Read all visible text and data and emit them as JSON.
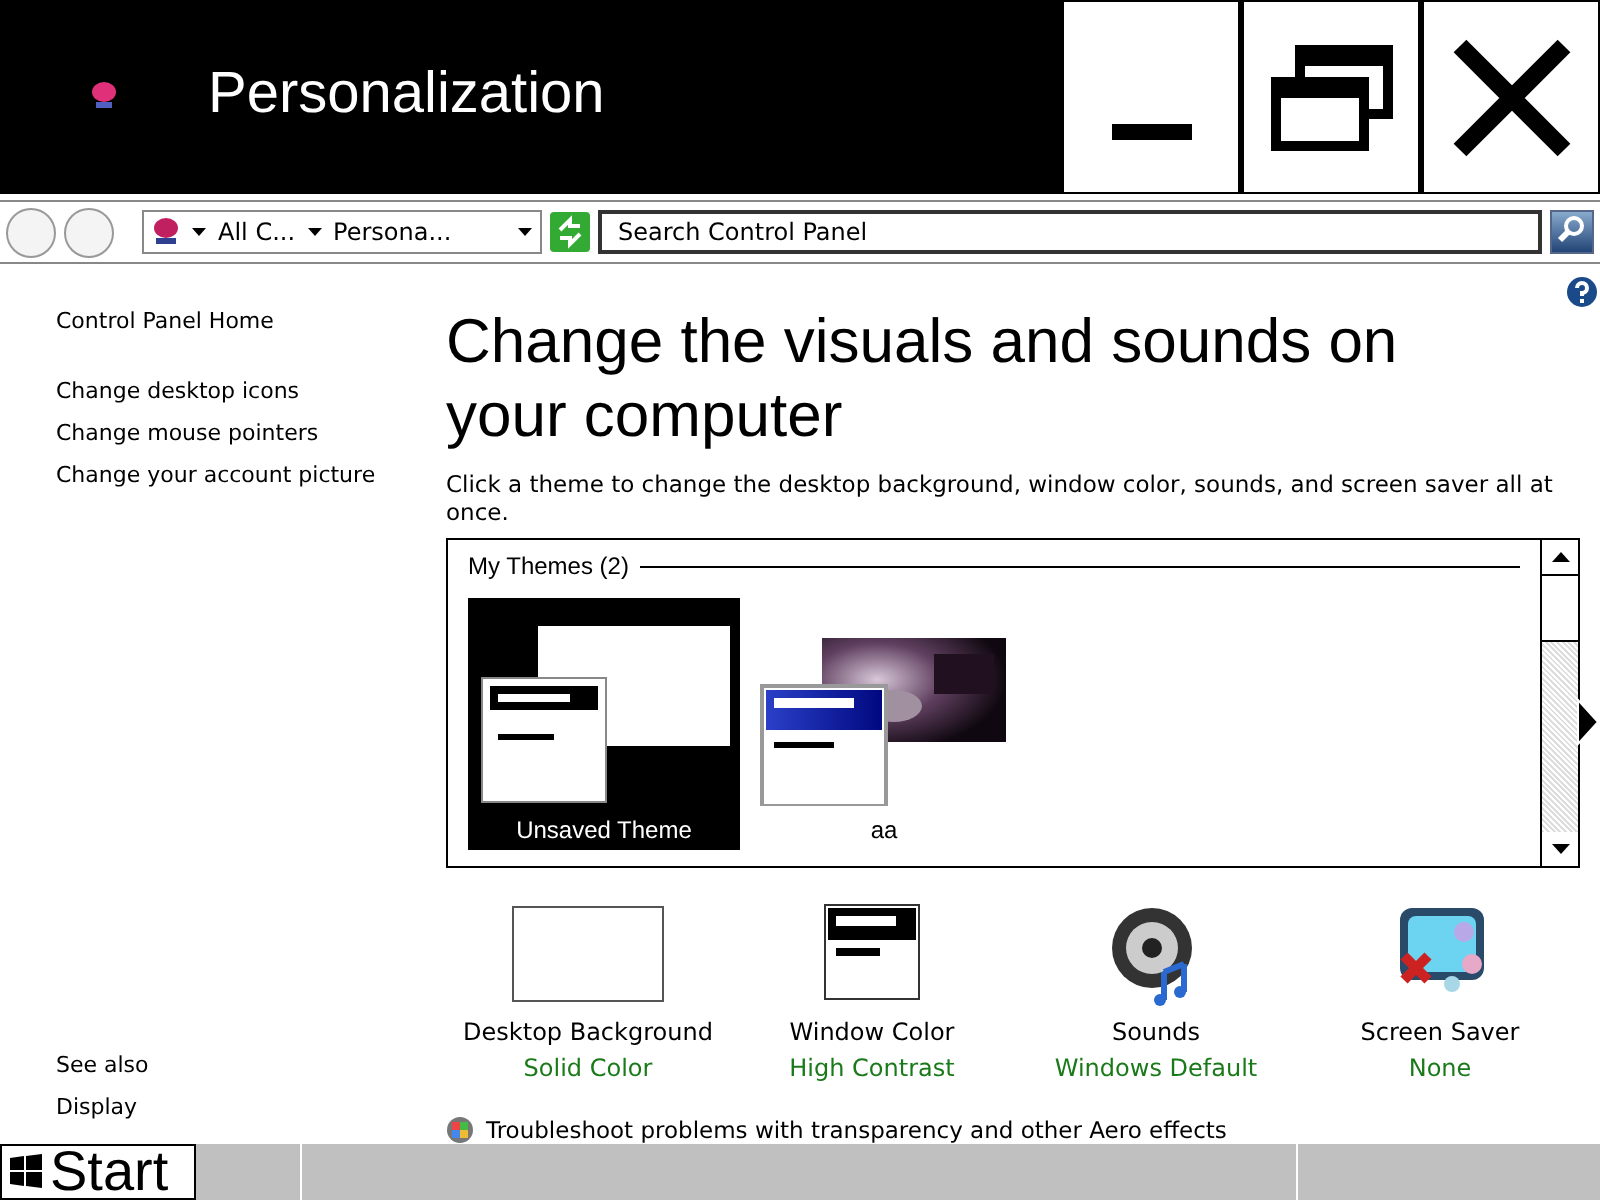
{
  "window": {
    "title": "Personalization"
  },
  "address_bar": {
    "breadcrumbs": [
      "All C...",
      "Persona..."
    ]
  },
  "search": {
    "placeholder": "Search Control Panel"
  },
  "sidebar": {
    "home": "Control Panel Home",
    "tasks": [
      "Change desktop icons",
      "Change mouse pointers",
      "Change your account picture"
    ],
    "see_also_heading": "See also",
    "see_also": [
      "Display"
    ]
  },
  "heading": "Change the visuals and sounds on your computer",
  "description": "Click a theme to change the desktop background, window color, sounds, and screen saver all at once.",
  "themes": {
    "group": "My Themes (2)",
    "items": [
      {
        "name": "Unsaved Theme",
        "selected": true,
        "kind": "high-contrast"
      },
      {
        "name": "aa",
        "selected": false,
        "kind": "photo"
      }
    ]
  },
  "settings": [
    {
      "label": "Desktop Background",
      "value": "Solid Color",
      "kind": "background"
    },
    {
      "label": "Window Color",
      "value": "High Contrast",
      "kind": "window"
    },
    {
      "label": "Sounds",
      "value": "Windows Default",
      "kind": "sounds"
    },
    {
      "label": "Screen Saver",
      "value": "None",
      "kind": "screensaver"
    }
  ],
  "troubleshoot": "Troubleshoot problems with transparency and other Aero effects",
  "taskbar": {
    "start": "Start"
  }
}
